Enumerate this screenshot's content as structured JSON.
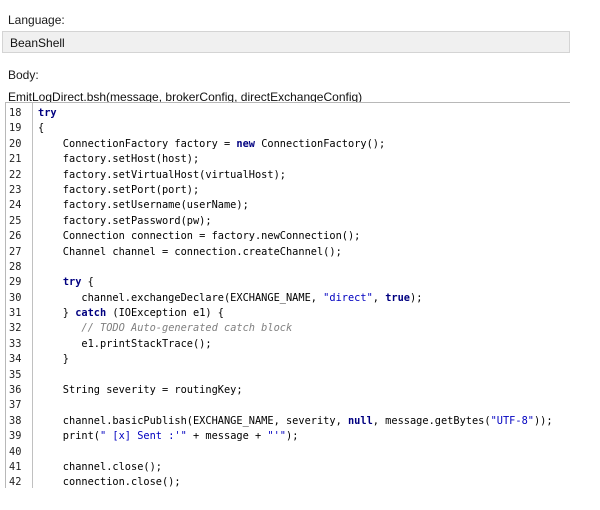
{
  "language": {
    "label": "Language:",
    "selected": "BeanShell"
  },
  "body": {
    "label": "Body:",
    "script_signature": "EmitLogDirect.bsh(message, brokerConfig, directExchangeConfig)"
  },
  "code_lines": [
    {
      "n": "18",
      "t": [
        {
          "k": "kw",
          "s": "try"
        }
      ]
    },
    {
      "n": "19",
      "t": [
        {
          "k": "p",
          "s": "{"
        }
      ]
    },
    {
      "n": "20",
      "t": [
        {
          "k": "p",
          "s": "    ConnectionFactory factory = "
        },
        {
          "k": "kw",
          "s": "new"
        },
        {
          "k": "p",
          "s": " ConnectionFactory();"
        }
      ]
    },
    {
      "n": "21",
      "t": [
        {
          "k": "p",
          "s": "    factory.setHost(host);"
        }
      ]
    },
    {
      "n": "22",
      "t": [
        {
          "k": "p",
          "s": "    factory.setVirtualHost(virtualHost);"
        }
      ]
    },
    {
      "n": "23",
      "t": [
        {
          "k": "p",
          "s": "    factory.setPort(port);"
        }
      ]
    },
    {
      "n": "24",
      "t": [
        {
          "k": "p",
          "s": "    factory.setUsername(userName);"
        }
      ]
    },
    {
      "n": "25",
      "t": [
        {
          "k": "p",
          "s": "    factory.setPassword(pw);"
        }
      ]
    },
    {
      "n": "26",
      "t": [
        {
          "k": "p",
          "s": "    Connection connection = factory.newConnection();"
        }
      ]
    },
    {
      "n": "27",
      "t": [
        {
          "k": "p",
          "s": "    Channel channel = connection.createChannel();"
        }
      ]
    },
    {
      "n": "28",
      "t": []
    },
    {
      "n": "29",
      "t": [
        {
          "k": "p",
          "s": "    "
        },
        {
          "k": "kw",
          "s": "try"
        },
        {
          "k": "p",
          "s": " {"
        }
      ]
    },
    {
      "n": "30",
      "t": [
        {
          "k": "p",
          "s": "       channel.exchangeDeclare(EXCHANGE_NAME, "
        },
        {
          "k": "str",
          "s": "\"direct\""
        },
        {
          "k": "p",
          "s": ", "
        },
        {
          "k": "kw",
          "s": "true"
        },
        {
          "k": "p",
          "s": ");"
        }
      ]
    },
    {
      "n": "31",
      "t": [
        {
          "k": "p",
          "s": "    } "
        },
        {
          "k": "kw",
          "s": "catch"
        },
        {
          "k": "p",
          "s": " (IOException e1) {"
        }
      ]
    },
    {
      "n": "32",
      "t": [
        {
          "k": "p",
          "s": "       "
        },
        {
          "k": "com",
          "s": "// TODO Auto-generated catch block"
        }
      ]
    },
    {
      "n": "33",
      "t": [
        {
          "k": "p",
          "s": "       e1.printStackTrace();"
        }
      ]
    },
    {
      "n": "34",
      "t": [
        {
          "k": "p",
          "s": "    }"
        }
      ]
    },
    {
      "n": "35",
      "t": []
    },
    {
      "n": "36",
      "t": [
        {
          "k": "p",
          "s": "    String severity = routingKey;"
        }
      ]
    },
    {
      "n": "37",
      "t": []
    },
    {
      "n": "38",
      "t": [
        {
          "k": "p",
          "s": "    channel.basicPublish(EXCHANGE_NAME, severity, "
        },
        {
          "k": "kw",
          "s": "null"
        },
        {
          "k": "p",
          "s": ", message.getBytes("
        },
        {
          "k": "str",
          "s": "\"UTF-8\""
        },
        {
          "k": "p",
          "s": "));"
        }
      ]
    },
    {
      "n": "39",
      "t": [
        {
          "k": "p",
          "s": "    print("
        },
        {
          "k": "str",
          "s": "\" [x] Sent :'\""
        },
        {
          "k": "p",
          "s": " + message + "
        },
        {
          "k": "str",
          "s": "\"'\""
        },
        {
          "k": "p",
          "s": ");"
        }
      ]
    },
    {
      "n": "40",
      "t": []
    },
    {
      "n": "41",
      "t": [
        {
          "k": "p",
          "s": "    channel.close();"
        }
      ]
    },
    {
      "n": "42",
      "t": [
        {
          "k": "p",
          "s": "    connection.close();"
        }
      ]
    }
  ]
}
